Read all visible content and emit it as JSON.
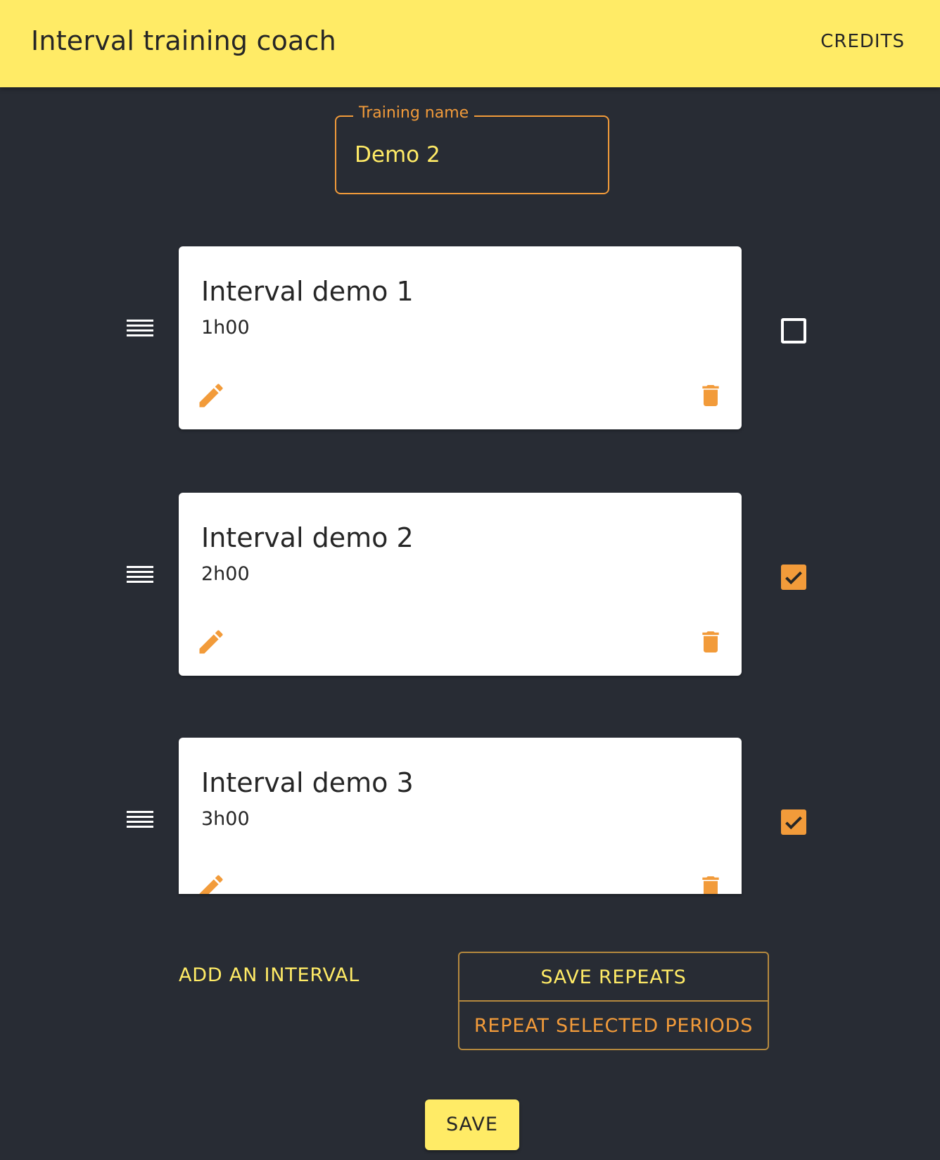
{
  "header": {
    "title": "Interval training coach",
    "credits_label": "CREDITS"
  },
  "training_name": {
    "label": "Training name",
    "value": "Demo 2"
  },
  "intervals": [
    {
      "title": "Interval demo 1",
      "duration": "1h00",
      "selected": false
    },
    {
      "title": "Interval demo 2",
      "duration": "2h00",
      "selected": true
    },
    {
      "title": "Interval demo 3",
      "duration": "3h00",
      "selected": true
    }
  ],
  "actions": {
    "add_interval": "ADD AN INTERVAL",
    "save_repeats": "SAVE REPEATS",
    "repeat_selected": "REPEAT SELECTED PERIODS",
    "save": "SAVE"
  },
  "colors": {
    "accent_yellow": "#ffeb66",
    "accent_orange": "#f29b3a",
    "background": "#282c34"
  }
}
